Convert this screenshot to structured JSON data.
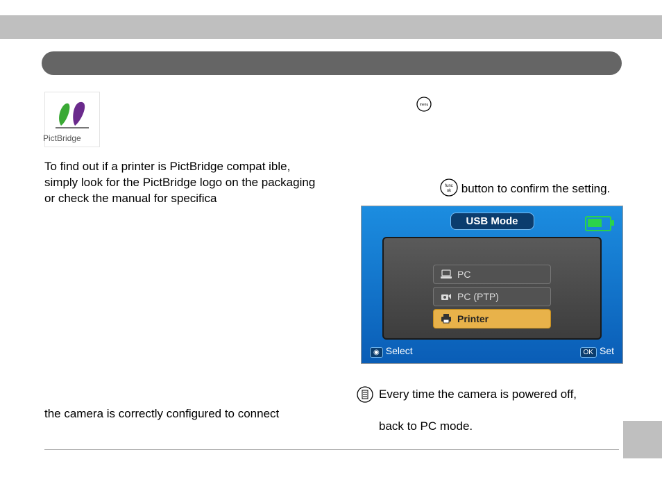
{
  "pictbridge": {
    "caption": "PictBridge"
  },
  "left": {
    "para1": "To find out if a printer is PictBridge compat ible, simply look for the PictBridge logo on the packaging or check the manual for specifica",
    "para2": "the camera is correctly configured to connect"
  },
  "right": {
    "confirm": " button to confirm the setting.",
    "note_line1": "Every time the camera is powered off,",
    "note_line2": "back to PC mode."
  },
  "lcd": {
    "title": "USB Mode",
    "options": {
      "pc": "PC",
      "ptp": "PC (PTP)",
      "printer": "Printer"
    },
    "bottom_left": "Select",
    "bottom_right_prefix": "OK",
    "bottom_right": "Set"
  }
}
